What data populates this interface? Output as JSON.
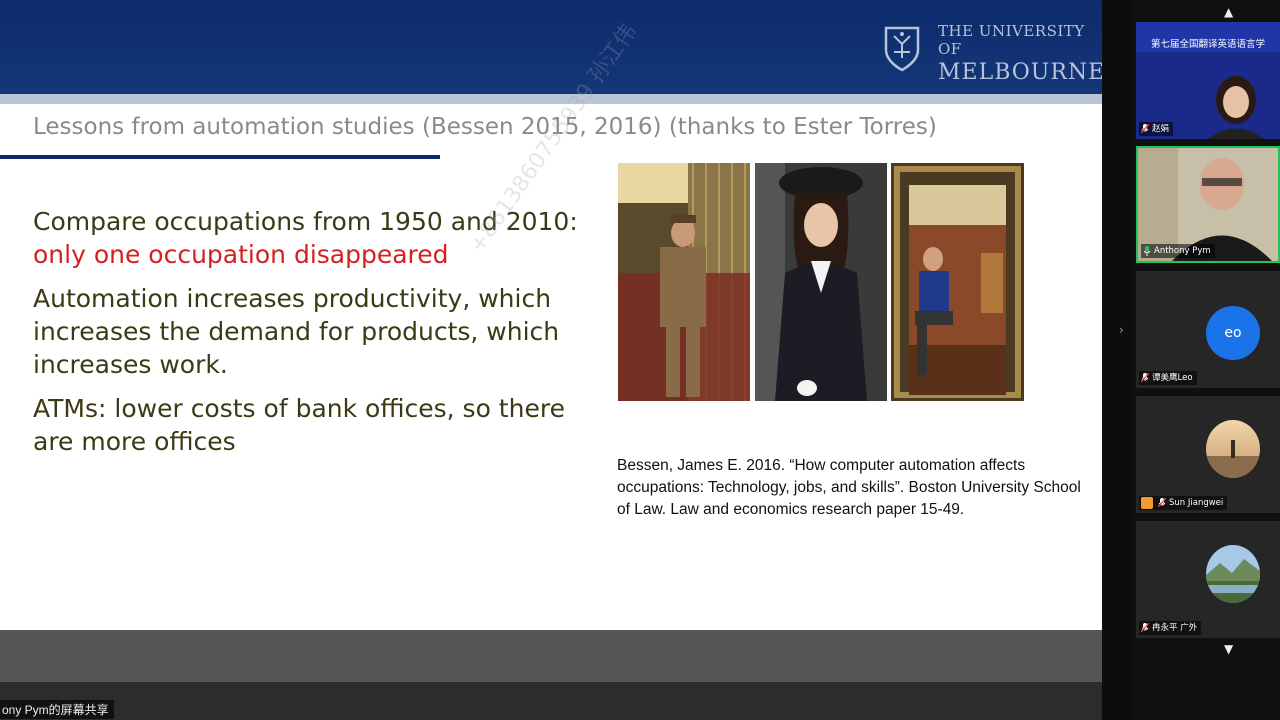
{
  "slide": {
    "university_line1": "THE UNIVERSITY OF",
    "university_line2": "MELBOURNE",
    "title": "Lessons from automation studies  (Bessen 2015, 2016) (thanks to Ester Torres)",
    "bullets": [
      {
        "text": "Compare occupations from 1950 and 2010: ",
        "highlight": "only one occupation disappeared"
      },
      {
        "text": "Automation increases productivity, which increases the demand for products, which increases work."
      },
      {
        "text": "ATMs: lower costs of bank offices, so there are more offices"
      }
    ],
    "citation": "Bessen, James E. 2016. “How computer automation affects occupations: Technology, jobs, and skills”. Boston University School of Law. Law and economics research paper 15-49.",
    "watermark": "+8613860755939 孙江伟"
  },
  "share": {
    "label": "ony Pym的屏幕共享"
  },
  "participants": [
    {
      "name": "赵娟",
      "type": "video",
      "slide_title": "第七届全国翻译英语语言学"
    },
    {
      "name": "Anthony Pym",
      "type": "video",
      "speaking": true
    },
    {
      "name": "谭美鹰Leo",
      "type": "initials",
      "initials": "eo"
    },
    {
      "name": "Sun Jiangwei",
      "type": "avatar"
    },
    {
      "name": "冉永平 广外",
      "type": "avatar"
    }
  ],
  "colors": {
    "header_blue": "#0d2b6b",
    "highlight_red": "#d42020",
    "body_text": "#3c3a14",
    "speaking_border": "#23c25a",
    "initials_avatar": "#1a73e8"
  }
}
